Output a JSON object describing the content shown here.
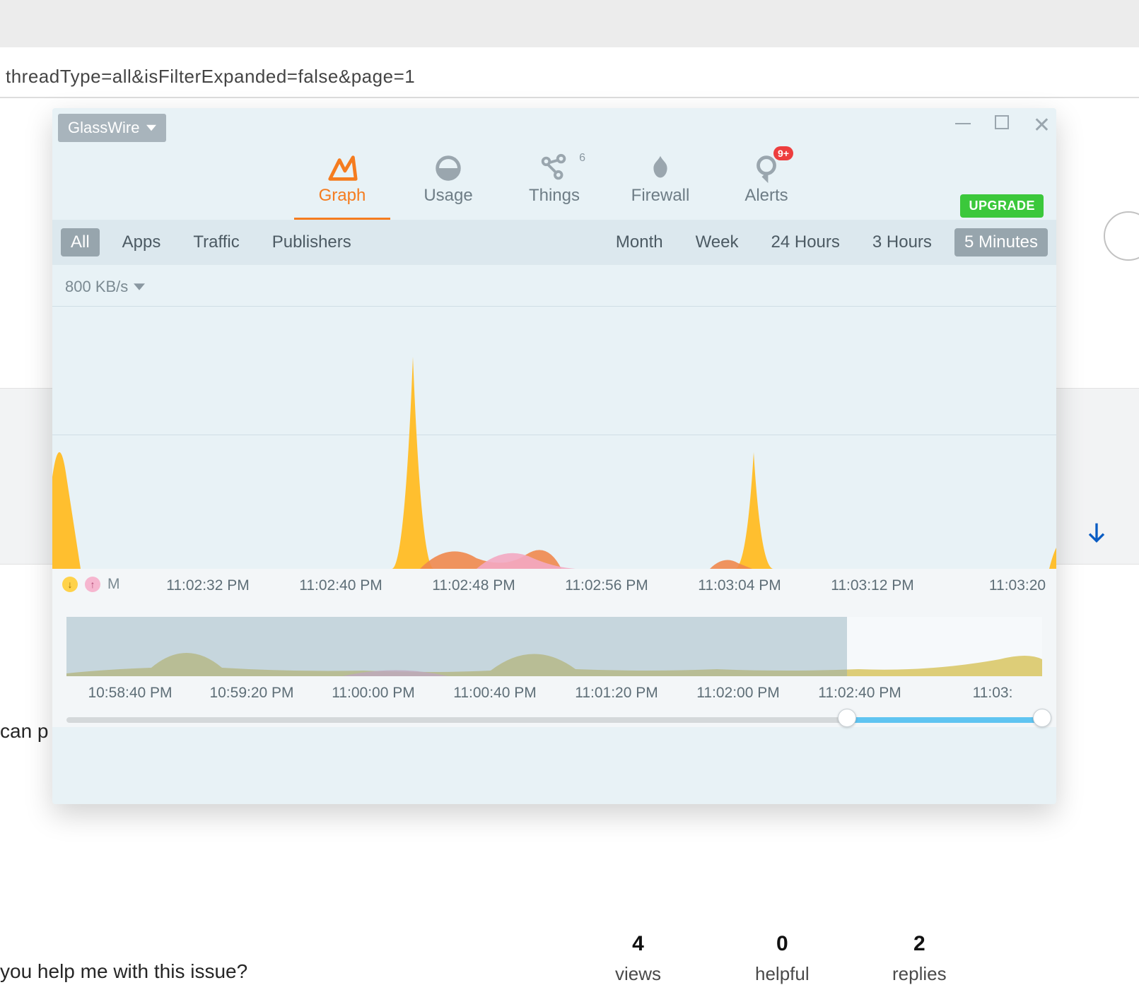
{
  "browser": {
    "url_fragment": "threadType=all&isFilterExpanded=false&page=1"
  },
  "background": {
    "left_clip1": "can p",
    "left_clip2": "  you help me with this issue?",
    "stats": {
      "views_n": "4",
      "views_l": "views",
      "helpful_n": "0",
      "helpful_l": "helpful",
      "replies_n": "2",
      "replies_l": "replies"
    }
  },
  "glasswire": {
    "title": "GlassWire",
    "upgrade": "UPGRADE",
    "tabs": {
      "graph": "Graph",
      "usage": "Usage",
      "things": "Things",
      "things_count": "6",
      "firewall": "Firewall",
      "alerts": "Alerts",
      "alerts_badge": "9+"
    },
    "filters": {
      "all": "All",
      "apps": "Apps",
      "traffic": "Traffic",
      "publishers": "Publishers"
    },
    "ranges": {
      "month": "Month",
      "week": "Week",
      "h24": "24 Hours",
      "h3": "3 Hours",
      "m5": "5 Minutes"
    },
    "yscale": "800 KB/s",
    "legend_m": "M",
    "xaxis_main": [
      "11:02:32 PM",
      "11:02:40 PM",
      "11:02:48 PM",
      "11:02:56 PM",
      "11:03:04 PM",
      "11:03:12 PM",
      "11:03:20"
    ],
    "xaxis_over": [
      "10:58:40 PM",
      "10:59:20 PM",
      "11:00:00 PM",
      "11:00:40 PM",
      "11:01:20 PM",
      "11:02:00 PM",
      "11:02:40 PM",
      "11:03:"
    ]
  },
  "chart_data": {
    "type": "area",
    "title": "Network traffic — 5 Minutes view",
    "ylabel": "KB/s",
    "ylim": [
      0,
      800
    ],
    "x": [
      "11:02:32",
      "11:02:40",
      "11:02:48",
      "11:02:56",
      "11:03:04",
      "11:03:12",
      "11:03:20"
    ],
    "series": [
      {
        "name": "Download (yellow)",
        "values": [
          230,
          0,
          700,
          0,
          0,
          300,
          0
        ]
      },
      {
        "name": "Upload (pink/orange)",
        "values": [
          0,
          0,
          60,
          40,
          0,
          30,
          0
        ]
      }
    ],
    "overview": {
      "x": [
        "10:58:40",
        "10:59:20",
        "11:00:00",
        "11:00:40",
        "11:01:20",
        "11:02:00",
        "11:02:40",
        "11:03:20"
      ],
      "values": [
        10,
        55,
        12,
        8,
        50,
        10,
        12,
        30
      ],
      "selection": [
        "11:02:20",
        "11:03:20"
      ]
    }
  }
}
